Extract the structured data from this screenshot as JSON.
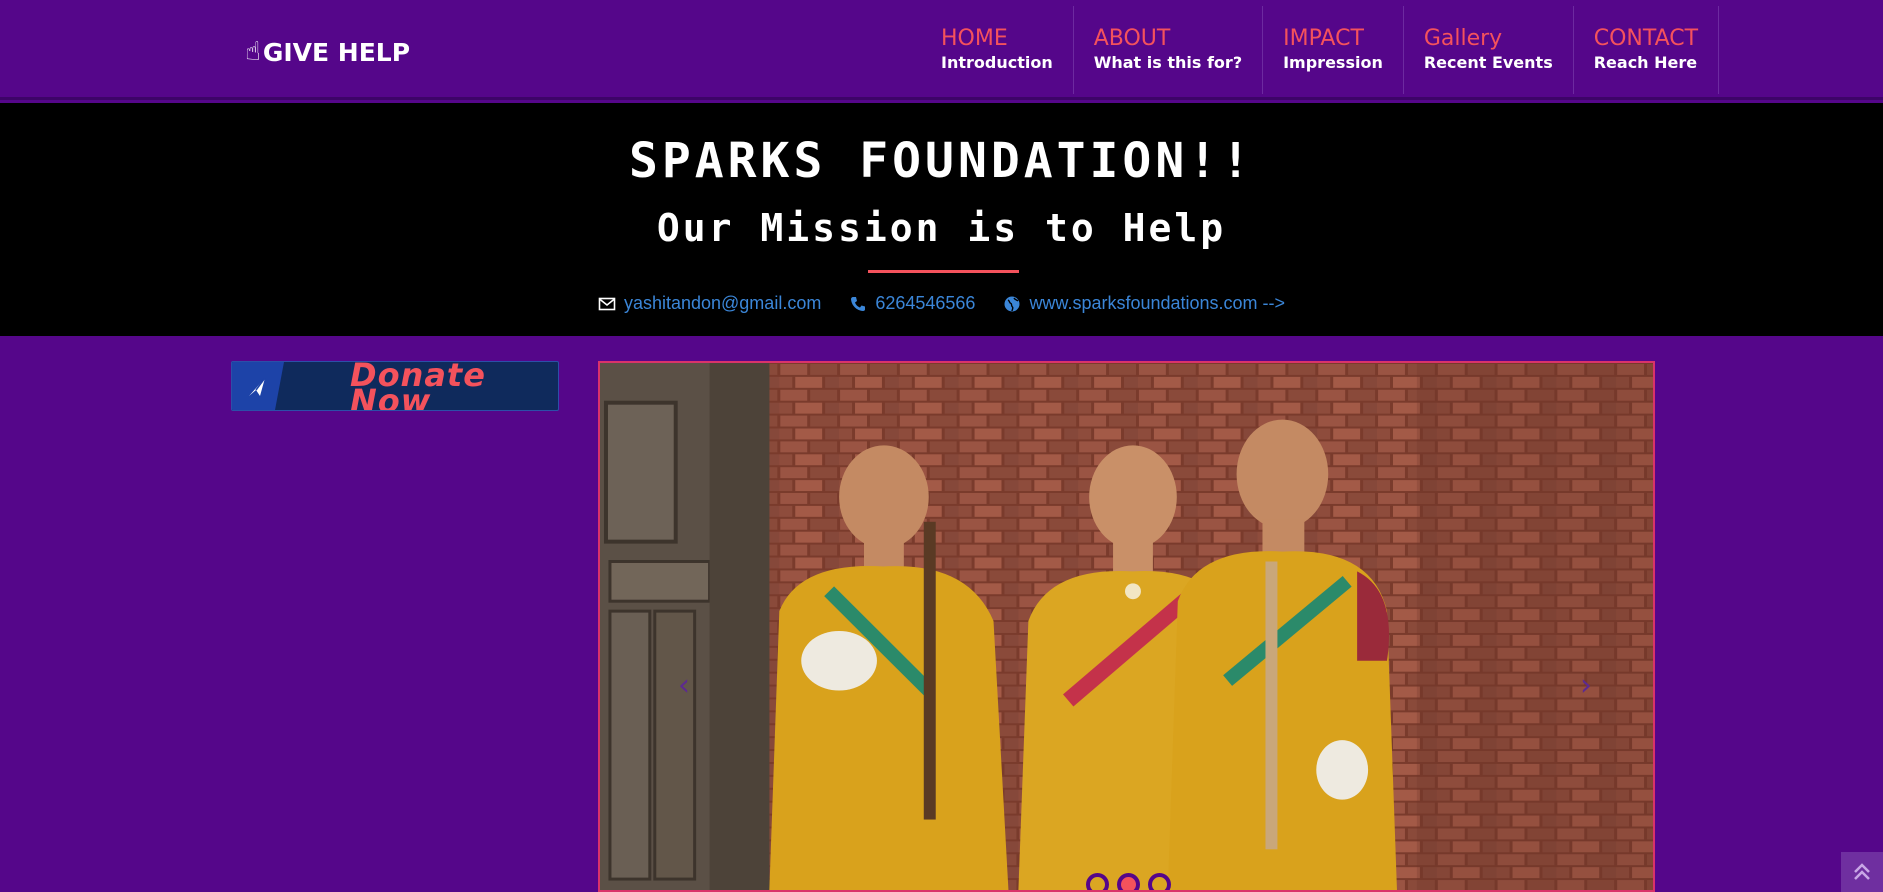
{
  "brand": {
    "label": "GIVE HELP",
    "icon": "hand-pointing-up-icon"
  },
  "nav": {
    "items": [
      {
        "title": "HOME",
        "sub": "Introduction"
      },
      {
        "title": "ABOUT",
        "sub": "What is this for?"
      },
      {
        "title": "IMPACT",
        "sub": "Impression"
      },
      {
        "title": "Gallery",
        "sub": "Recent Events"
      },
      {
        "title": "CONTACT",
        "sub": "Reach Here"
      }
    ]
  },
  "header": {
    "title": "SPARKS FOUNDATION!!",
    "subtitle": "Our Mission is to Help",
    "email": "yashitandon@gmail.com",
    "phone": "6264546566",
    "website": "www.sparksfoundations.com -->"
  },
  "donate": {
    "label": "Donate Now",
    "icon": "paper-plane-icon"
  },
  "carousel": {
    "prev_icon": "chevron-left-icon",
    "next_icon": "chevron-right-icon",
    "slides": 3,
    "active_index": 1
  },
  "colors": {
    "page_bg": "#55068a",
    "accent": "#f4525c",
    "link": "#3b86d8",
    "header_bg": "#000000"
  }
}
